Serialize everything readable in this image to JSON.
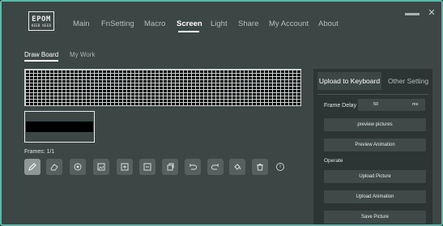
{
  "window": {
    "logo": {
      "line1": "EPOM",
      "line2": "KEEB KEEB"
    },
    "close_glyph": "✕"
  },
  "nav": {
    "items": [
      {
        "label": "Main"
      },
      {
        "label": "FnSetting"
      },
      {
        "label": "Macro"
      },
      {
        "label": "Screen",
        "active": true
      },
      {
        "label": "Light"
      },
      {
        "label": "Share"
      },
      {
        "label": "My Account"
      },
      {
        "label": "About"
      }
    ]
  },
  "subtabs": {
    "draw_board": "Draw Board",
    "my_work": "My Work"
  },
  "frames": {
    "label": "Frames: 1/1"
  },
  "toolbar": {
    "tools": [
      {
        "icon": "pencil-icon",
        "active": true
      },
      {
        "icon": "eraser-icon"
      },
      {
        "icon": "circle-fill-icon"
      },
      {
        "icon": "import-image-icon"
      },
      {
        "icon": "add-frame-icon"
      },
      {
        "icon": "remove-frame-icon"
      },
      {
        "icon": "copy-frame-icon"
      },
      {
        "icon": "undo-icon"
      },
      {
        "icon": "redo-icon"
      },
      {
        "icon": "fill-bucket-icon"
      },
      {
        "icon": "trash-icon"
      }
    ],
    "info_glyph": "i"
  },
  "panel": {
    "tab_upload": "Upload to Keyboard",
    "tab_other": "Other Setting",
    "frame_delay_label": "Frame Delay",
    "frame_delay_value": "50",
    "frame_delay_unit": "ms",
    "preview_pictures": "preview pictures",
    "preview_animation": "Preview Animation",
    "operate_label": "Operate",
    "upload_picture": "Upload Picture",
    "upload_animation": "Upload Animation",
    "save_picture": "Save Picture"
  },
  "colors": {
    "accent": "#5fb8a8",
    "background": "#3b4645",
    "panel": "#2c3534",
    "led_off": "#000000"
  }
}
